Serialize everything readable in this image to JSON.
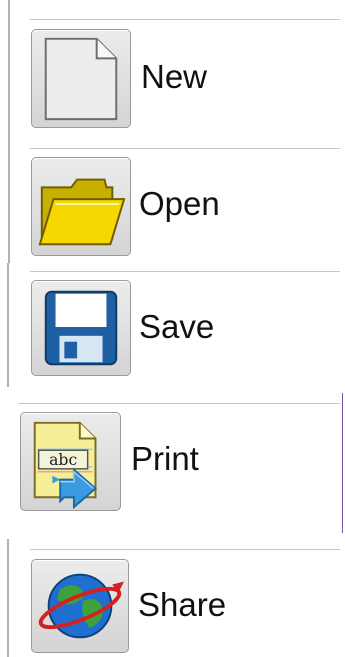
{
  "menu": {
    "items": [
      {
        "id": "new",
        "label": "New",
        "icon": "new-document-icon"
      },
      {
        "id": "open",
        "label": "Open",
        "icon": "folder-icon"
      },
      {
        "id": "save",
        "label": "Save",
        "icon": "floppy-disk-icon"
      },
      {
        "id": "print",
        "label": "Print",
        "icon": "print-document-icon",
        "icon_text": "abc"
      },
      {
        "id": "share",
        "label": "Share",
        "icon": "globe-share-icon"
      }
    ]
  },
  "colors": {
    "folder": "#f5d800",
    "floppy": "#1f5fa3",
    "print_paper": "#f7ef98",
    "print_arrow": "#3a9be0",
    "globe_ocean": "#1f6fd1",
    "globe_land": "#3ea23a",
    "orbit": "#d42020"
  }
}
